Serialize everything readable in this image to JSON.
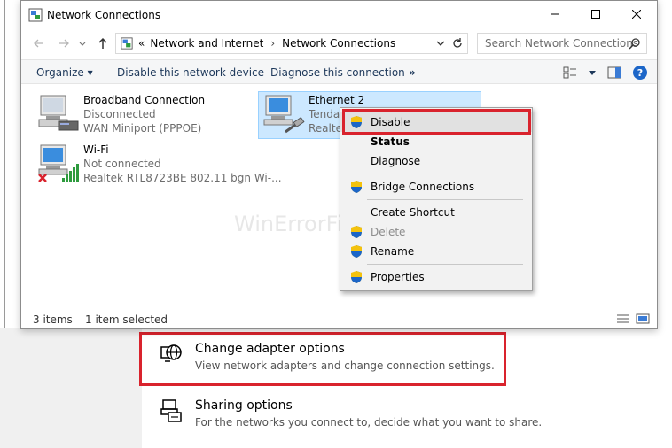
{
  "window": {
    "title": "Network Connections"
  },
  "address": {
    "breadcrumb_overflow": "«",
    "crumb1": "Network and Internet",
    "crumb2": "Network Connections",
    "search_placeholder": "Search Network Connections"
  },
  "toolbar": {
    "organize": "Organize",
    "disable_device": "Disable this network device",
    "diagnose": "Diagnose this connection",
    "more": "»"
  },
  "connections": [
    {
      "name": "Broadband Connection",
      "status": "Disconnected",
      "device": "WAN Miniport (PPPOE)"
    },
    {
      "name": "Wi-Fi",
      "status": "Not connected",
      "device": "Realtek RTL8723BE 802.11 bgn Wi-..."
    },
    {
      "name": "Ethernet 2",
      "status": "Tenda_",
      "device": "Realtek"
    }
  ],
  "status": {
    "items": "3 items",
    "selected": "1 item selected"
  },
  "context_menu": {
    "items": [
      {
        "label": "Disable"
      },
      {
        "label": "Status"
      },
      {
        "label": "Diagnose"
      },
      {
        "label": "Bridge Connections"
      },
      {
        "label": "Create Shortcut"
      },
      {
        "label": "Delete"
      },
      {
        "label": "Rename"
      },
      {
        "label": "Properties"
      }
    ]
  },
  "settings": {
    "adapter": {
      "title": "Change adapter options",
      "desc": "View network adapters and change connection settings."
    },
    "sharing": {
      "title": "Sharing options",
      "desc": "For the networks you connect to, decide what you want to share."
    }
  },
  "watermark": "WinErrorFixer.com",
  "colors": {
    "highlight": "#d9232d",
    "selection": "#cce8ff",
    "link_blue": "#1e395b"
  }
}
